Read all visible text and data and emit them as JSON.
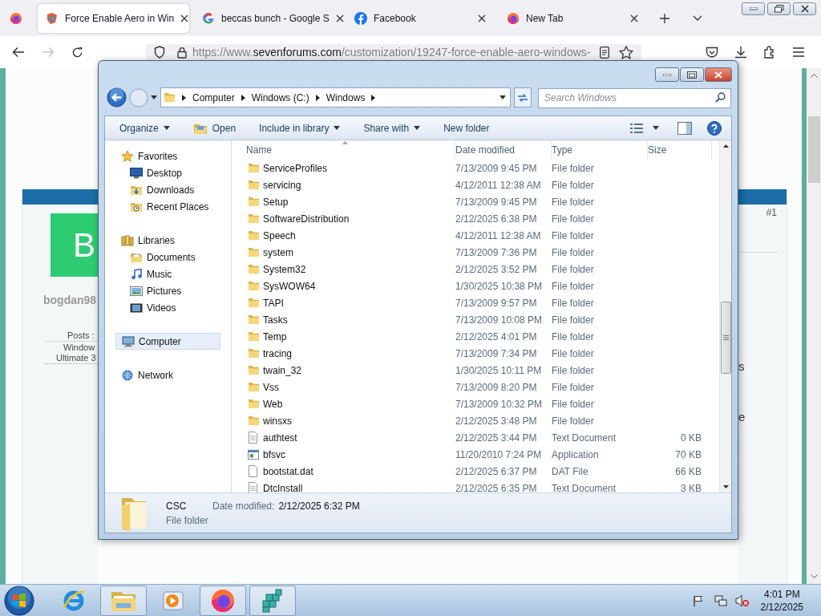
{
  "browser": {
    "tabs": [
      {
        "title": "Force Enable Aero in Win",
        "kind": "site",
        "selected": true
      },
      {
        "title": "beccas bunch - Google S",
        "kind": "google",
        "selected": false
      },
      {
        "title": "Facebook",
        "kind": "facebook",
        "selected": false
      },
      {
        "title": "New Tab",
        "kind": "firefox",
        "selected": false
      }
    ],
    "forward_enabled": false,
    "url": {
      "prefix": "https://www.",
      "host": "sevenforums.com",
      "path": "/customization/19247-force-enable-aero-windows-"
    }
  },
  "webpage": {
    "post_number": "#1",
    "avatar_letter": "B",
    "username": "bogdan98",
    "posts": "Posts :",
    "os_line_1": "Window",
    "os_line_2": "Ultimate 3",
    "fragments": [
      "s",
      "e"
    ]
  },
  "explorer": {
    "breadcrumb": [
      "Computer",
      "Windows (C:)",
      "Windows"
    ],
    "search_placeholder": "Search Windows",
    "toolbar": [
      {
        "label": "Organize",
        "kind": "plain",
        "dropdown": true
      },
      {
        "label": "Open",
        "kind": "open",
        "dropdown": false
      },
      {
        "label": "Include in library",
        "kind": "plain",
        "dropdown": true
      },
      {
        "label": "Share with",
        "kind": "plain",
        "dropdown": true
      },
      {
        "label": "New folder",
        "kind": "plain",
        "dropdown": false
      }
    ],
    "nav": [
      {
        "label": "Favorites",
        "kind": "star",
        "selected": false,
        "children": [
          {
            "label": "Desktop",
            "kind": "desktop",
            "selected": false
          },
          {
            "label": "Downloads",
            "kind": "downloads",
            "selected": false
          },
          {
            "label": "Recent Places",
            "kind": "recent",
            "selected": false
          }
        ]
      },
      {
        "label": "Libraries",
        "kind": "library",
        "selected": false,
        "children": [
          {
            "label": "Documents",
            "kind": "documents",
            "selected": false
          },
          {
            "label": "Music",
            "kind": "music",
            "selected": false
          },
          {
            "label": "Pictures",
            "kind": "pictures",
            "selected": false
          },
          {
            "label": "Videos",
            "kind": "videos",
            "selected": false
          }
        ]
      },
      {
        "label": "Computer",
        "kind": "computer",
        "selected": true
      },
      {
        "label": "Network",
        "kind": "network",
        "selected": false
      }
    ],
    "columns": [
      "Name",
      "Date modified",
      "Type",
      "Size"
    ],
    "rows": [
      {
        "name": "ServiceProfiles",
        "date": "7/13/2009 9:45 PM",
        "type": "File folder",
        "kind": "folder"
      },
      {
        "name": "servicing",
        "date": "4/12/2011 12:38 AM",
        "type": "File folder",
        "kind": "folder"
      },
      {
        "name": "Setup",
        "date": "7/13/2009 9:45 PM",
        "type": "File folder",
        "kind": "folder"
      },
      {
        "name": "SoftwareDistribution",
        "date": "2/12/2025 6:38 PM",
        "type": "File folder",
        "kind": "folder"
      },
      {
        "name": "Speech",
        "date": "4/12/2011 12:38 AM",
        "type": "File folder",
        "kind": "folder"
      },
      {
        "name": "system",
        "date": "7/13/2009 7:36 PM",
        "type": "File folder",
        "kind": "folder"
      },
      {
        "name": "System32",
        "date": "2/12/2025 3:52 PM",
        "type": "File folder",
        "kind": "folder"
      },
      {
        "name": "SysWOW64",
        "date": "1/30/2025 10:38 PM",
        "type": "File folder",
        "kind": "folder"
      },
      {
        "name": "TAPI",
        "date": "7/13/2009 9:57 PM",
        "type": "File folder",
        "kind": "folder"
      },
      {
        "name": "Tasks",
        "date": "7/13/2009 10:08 PM",
        "type": "File folder",
        "kind": "folder"
      },
      {
        "name": "Temp",
        "date": "2/12/2025 4:01 PM",
        "type": "File folder",
        "kind": "folder"
      },
      {
        "name": "tracing",
        "date": "7/13/2009 7:34 PM",
        "type": "File folder",
        "kind": "folder"
      },
      {
        "name": "twain_32",
        "date": "1/30/2025 10:11 PM",
        "type": "File folder",
        "kind": "folder"
      },
      {
        "name": "Vss",
        "date": "7/13/2009 8:20 PM",
        "type": "File folder",
        "kind": "folder"
      },
      {
        "name": "Web",
        "date": "7/13/2009 10:32 PM",
        "type": "File folder",
        "kind": "folder"
      },
      {
        "name": "winsxs",
        "date": "2/12/2025 3:48 PM",
        "type": "File folder",
        "kind": "folder"
      },
      {
        "name": "authtest",
        "date": "2/12/2025 3:44 PM",
        "type": "Text Document",
        "size": "0 KB",
        "kind": "text"
      },
      {
        "name": "bfsvc",
        "date": "11/20/2010 7:24 PM",
        "type": "Application",
        "size": "70 KB",
        "kind": "app"
      },
      {
        "name": "bootstat.dat",
        "date": "2/12/2025 6:37 PM",
        "type": "DAT File",
        "size": "66 KB",
        "kind": "file"
      },
      {
        "name": "DtcInstall",
        "date": "2/12/2025 6:35 PM",
        "type": "Text Document",
        "size": "3 KB",
        "kind": "text"
      }
    ],
    "details": {
      "name": "CSC",
      "date_label": "Date modified:",
      "date": "2/12/2025 6:32 PM",
      "type": "File folder"
    }
  },
  "taskbar": {
    "apps": [
      {
        "kind": "ie",
        "running": false
      },
      {
        "kind": "explorer",
        "running": true
      },
      {
        "kind": "media",
        "running": false
      },
      {
        "kind": "firefox",
        "running": true
      },
      {
        "kind": "cubes",
        "running": true
      }
    ],
    "time": "4:01 PM",
    "date": "2/12/2025"
  }
}
